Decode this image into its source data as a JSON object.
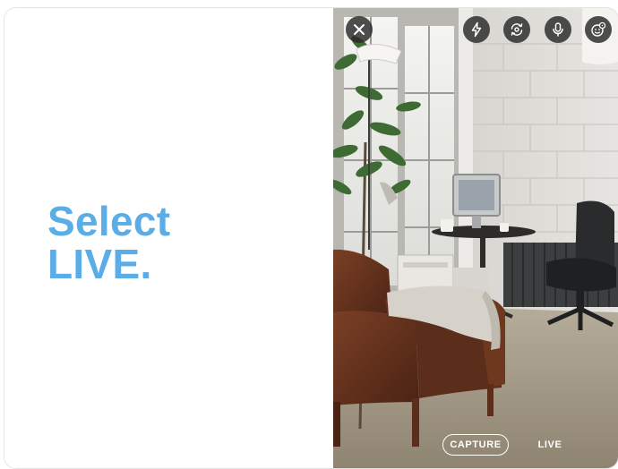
{
  "instruction": {
    "line1": "Select",
    "line2": "LIVE."
  },
  "camera": {
    "controls": {
      "close": "close-icon",
      "flash": "flash-icon",
      "flip": "flip-camera-icon",
      "mic": "microphone-icon",
      "effects": "face-effects-icon"
    },
    "modes": {
      "capture_label": "CAPTURE",
      "live_label": "LIVE"
    }
  },
  "colors": {
    "headline": "#5aade6",
    "control_bg": "#282828"
  }
}
